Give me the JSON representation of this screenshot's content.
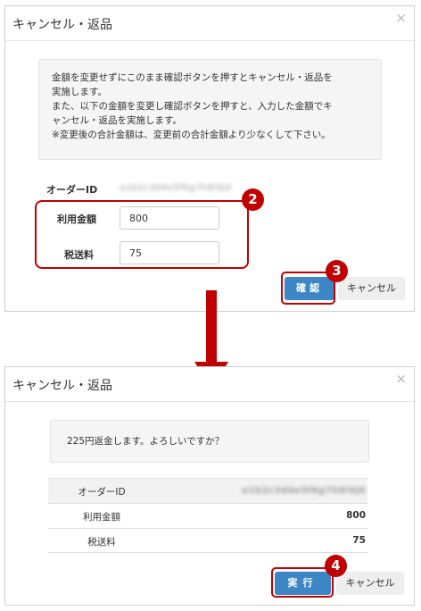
{
  "dialog1": {
    "title": "キャンセル・返品",
    "close_glyph": "×",
    "info_lines": [
      "金額を変更せずにこのまま確認ボタンを押すとキャンセル・返品を",
      "実施します。",
      "また、以下の金額を変更し確認ボタンを押すと、入力した金額でキ",
      "ャンセル・返品を実施します。",
      "※変更後の合計金額は、変更前の合計金額より少なくして下さい。"
    ],
    "order_id_label": "オーダーID",
    "order_id_value": "a1b2c3d4e5f6g7h8i9j0",
    "amount_label": "利用金額",
    "amount_value": "800",
    "tax_label": "税送料",
    "tax_value": "75",
    "confirm_button": "確認",
    "cancel_button": "キャンセル"
  },
  "dialog2": {
    "title": "キャンセル・返品",
    "close_glyph": "×",
    "message": "225円返金します。よろしいですか？",
    "rows": [
      {
        "label": "オーダーID",
        "value": "a1b2c3d4e5f6g7h8i9j0"
      },
      {
        "label": "利用金額",
        "value": "800"
      },
      {
        "label": "税送料",
        "value": "75"
      }
    ],
    "execute_button": "実行",
    "cancel_button": "キャンセル"
  },
  "markers": {
    "m2": "2",
    "m3": "3",
    "m4": "4"
  },
  "colors": {
    "accent": "#3d86c6",
    "annotation": "#c00000"
  }
}
